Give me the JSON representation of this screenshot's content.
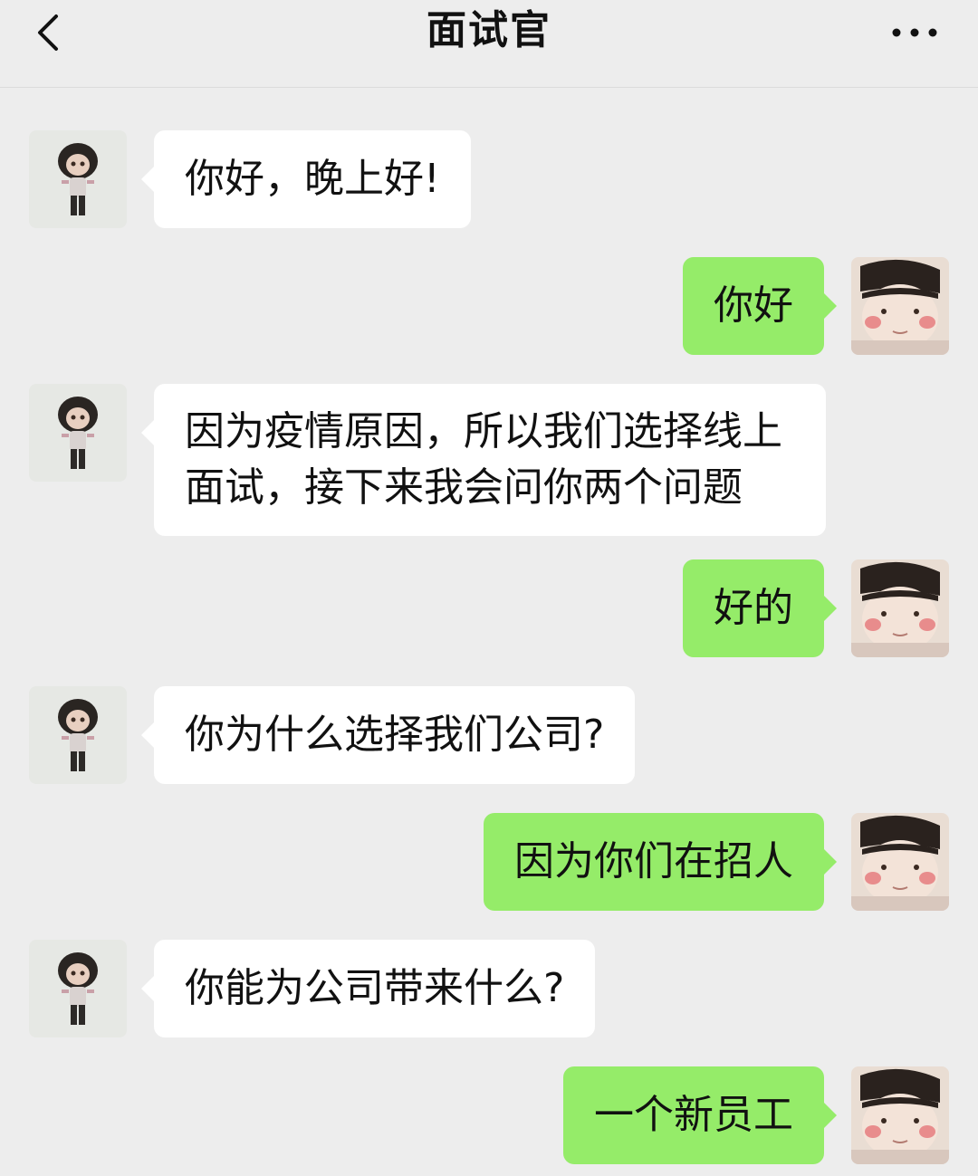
{
  "header": {
    "title": "面试官"
  },
  "icons": {
    "back": "chevron-left-icon",
    "more": "more-dots-icon"
  },
  "messages": [
    {
      "side": "in",
      "text": "你好，晚上好!"
    },
    {
      "side": "out",
      "text": "你好"
    },
    {
      "side": "in",
      "lines": [
        "因为疫情原因，所以我们选择线上",
        "面试，接下来我会问你两个问题"
      ]
    },
    {
      "side": "out",
      "text": "好的"
    },
    {
      "side": "in",
      "text": "你为什么选择我们公司?"
    },
    {
      "side": "out",
      "text": "因为你们在招人"
    },
    {
      "side": "in",
      "text": "你能为公司带来什么?"
    },
    {
      "side": "out",
      "text": "一个新员工"
    }
  ],
  "colors": {
    "background": "#ededed",
    "incoming_bubble": "#ffffff",
    "outgoing_bubble": "#95ec69"
  }
}
